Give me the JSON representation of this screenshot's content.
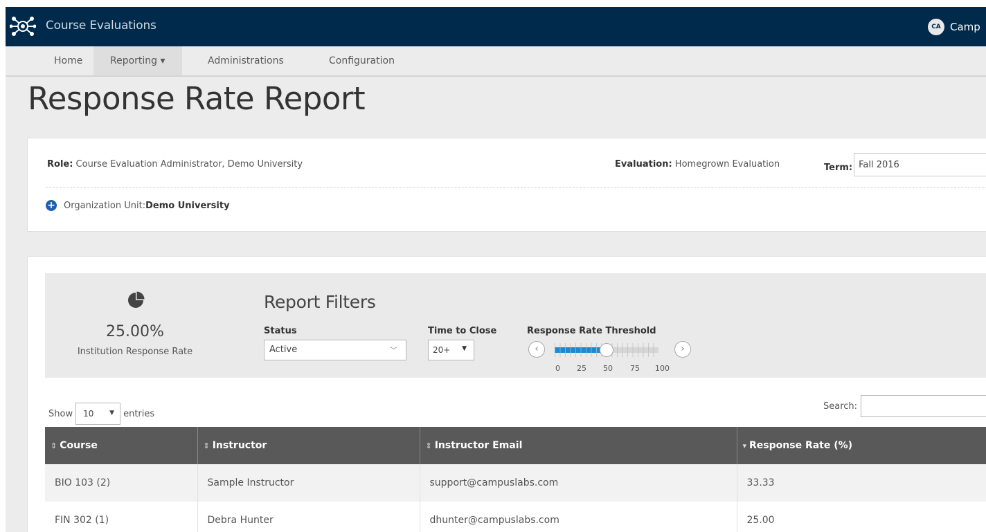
{
  "app": {
    "title": "Course Evaluations",
    "user_initials": "CA",
    "user_name": "Camp"
  },
  "nav": [
    {
      "label": "Home"
    },
    {
      "label": "Reporting ▾"
    },
    {
      "label": "Administrations"
    },
    {
      "label": "Configuration"
    }
  ],
  "page": {
    "title": "Response Rate Report"
  },
  "context": {
    "role_label": "Role:",
    "role_value": " Course Evaluation Administrator, Demo University",
    "evaluation_label": "Evaluation:",
    "evaluation_value": " Homegrown Evaluation",
    "term_label": "Term:",
    "term_value": "Fall 2016",
    "org_label": "Organization Unit: ",
    "org_value": "Demo University"
  },
  "summary": {
    "rate_value": "25.00%",
    "rate_label": "Institution Response Rate",
    "rate_fraction": 0.25
  },
  "filters": {
    "title": "Report Filters",
    "status_label": "Status",
    "status_value": "Active",
    "ttc_label": "Time to Close",
    "ttc_value": "20+",
    "threshold_label": "Response Rate Threshold",
    "threshold_value": 50,
    "threshold_ticks": [
      "0",
      "25",
      "50",
      "75",
      "100"
    ]
  },
  "table_controls": {
    "show_label": "Show",
    "length_value": "10",
    "entries_label": "entries",
    "search_label": "Search:"
  },
  "table": {
    "columns": [
      {
        "label": "Course",
        "sort": "⇕"
      },
      {
        "label": "Instructor",
        "sort": "⇕"
      },
      {
        "label": "Instructor Email",
        "sort": "⇕"
      },
      {
        "label": "Response Rate (%)",
        "sort": "▾"
      }
    ],
    "rows": [
      [
        "BIO 103 (2)",
        "Sample Instructor",
        "support@campuslabs.com",
        "33.33"
      ],
      [
        "FIN 302 (1)",
        "Debra Hunter",
        "dhunter@campuslabs.com",
        "25.00"
      ]
    ]
  },
  "colors": {
    "header_bg": "#002a4b",
    "accent": "#1a8ad4",
    "table_header": "#595959"
  }
}
